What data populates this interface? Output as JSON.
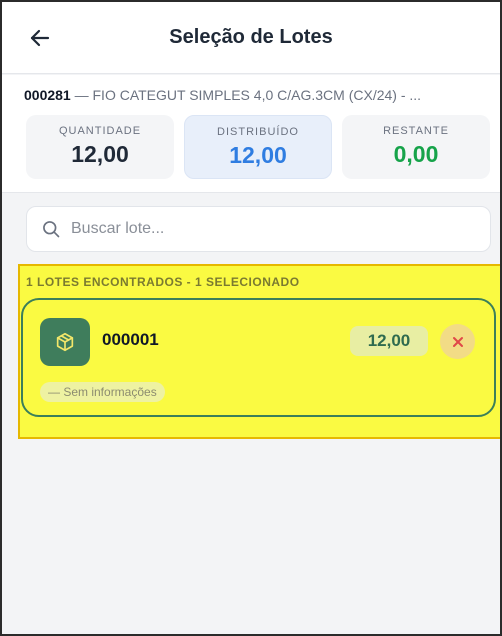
{
  "header": {
    "title": "Seleção de Lotes",
    "back_icon": "arrow-left-icon"
  },
  "product": {
    "code": "000281",
    "description": " — FIO CATEGUT SIMPLES 4,0 C/AG.3CM (CX/24) - ..."
  },
  "stats": {
    "quantidade": {
      "label": "QUANTIDADE",
      "value": "12,00"
    },
    "distribuido": {
      "label": "DISTRIBUÍDO",
      "value": "12,00"
    },
    "restante": {
      "label": "RESTANTE",
      "value": "0,00"
    }
  },
  "search": {
    "placeholder": "Buscar lote...",
    "value": ""
  },
  "lotes": {
    "summary": "1 LOTES ENCONTRADOS - 1 SELECIONADO",
    "items": [
      {
        "name": "000001",
        "quantity": "12,00",
        "info": "— Sem informações",
        "icon": "package-icon",
        "selected": true
      }
    ]
  },
  "colors": {
    "accent_green": "#3f7d5c",
    "distributed_blue": "#2f7de1",
    "remaining_green": "#16a34a",
    "highlight": "#fafa42"
  }
}
